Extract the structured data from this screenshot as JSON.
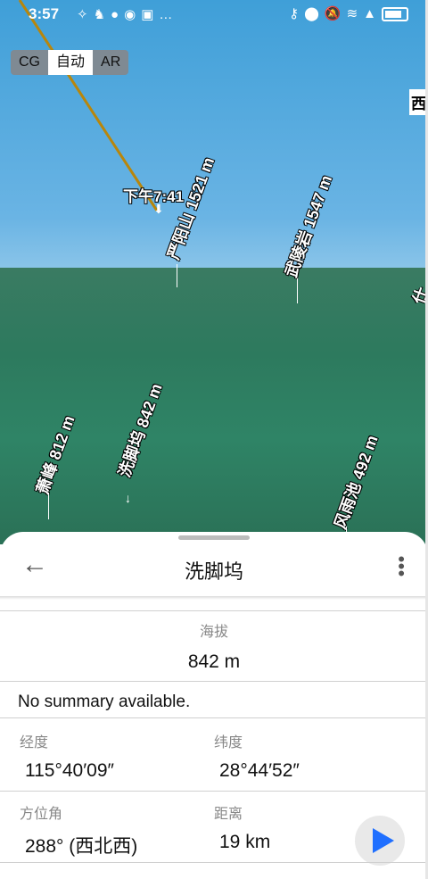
{
  "status_bar": {
    "time": "3:57",
    "left_icons": [
      "notification-icon",
      "cat-icon",
      "chat-icon",
      "bulb-icon",
      "app-icon",
      "more-dots-icon"
    ],
    "right_icons": [
      "key-icon",
      "location-icon",
      "mute-icon",
      "wifi-icon",
      "signal-icon",
      "battery-icon"
    ]
  },
  "view_modes": {
    "items": [
      "CG",
      "自动",
      "AR"
    ],
    "active": "自动"
  },
  "scene": {
    "track_time": "下午7:41",
    "peaks": [
      {
        "name": "严阳山",
        "elevation": "1521 m"
      },
      {
        "name": "武陵岩",
        "elevation": "1547 m"
      },
      {
        "name": "萧峰",
        "elevation": "812 m"
      },
      {
        "name": "洗脚坞",
        "elevation": "842 m"
      },
      {
        "name": "风雨池",
        "elevation": "492 m"
      }
    ],
    "edge_label_top": "西",
    "edge_label_right": "仕"
  },
  "sheet": {
    "title": "洗脚坞",
    "altitude_label": "海拔",
    "altitude_value": "842 m",
    "summary": "No summary available.",
    "longitude_label": "经度",
    "longitude_value": "115°40′09″",
    "latitude_label": "纬度",
    "latitude_value": "28°44′52″",
    "azimuth_label": "方位角",
    "azimuth_value": "288° (西北西)",
    "distance_label": "距离",
    "distance_value": "19 km"
  },
  "colors": {
    "sky": "#5aaee0",
    "terrain": "#2f7a60",
    "track": "#b8860b",
    "play": "#1f6fff"
  }
}
